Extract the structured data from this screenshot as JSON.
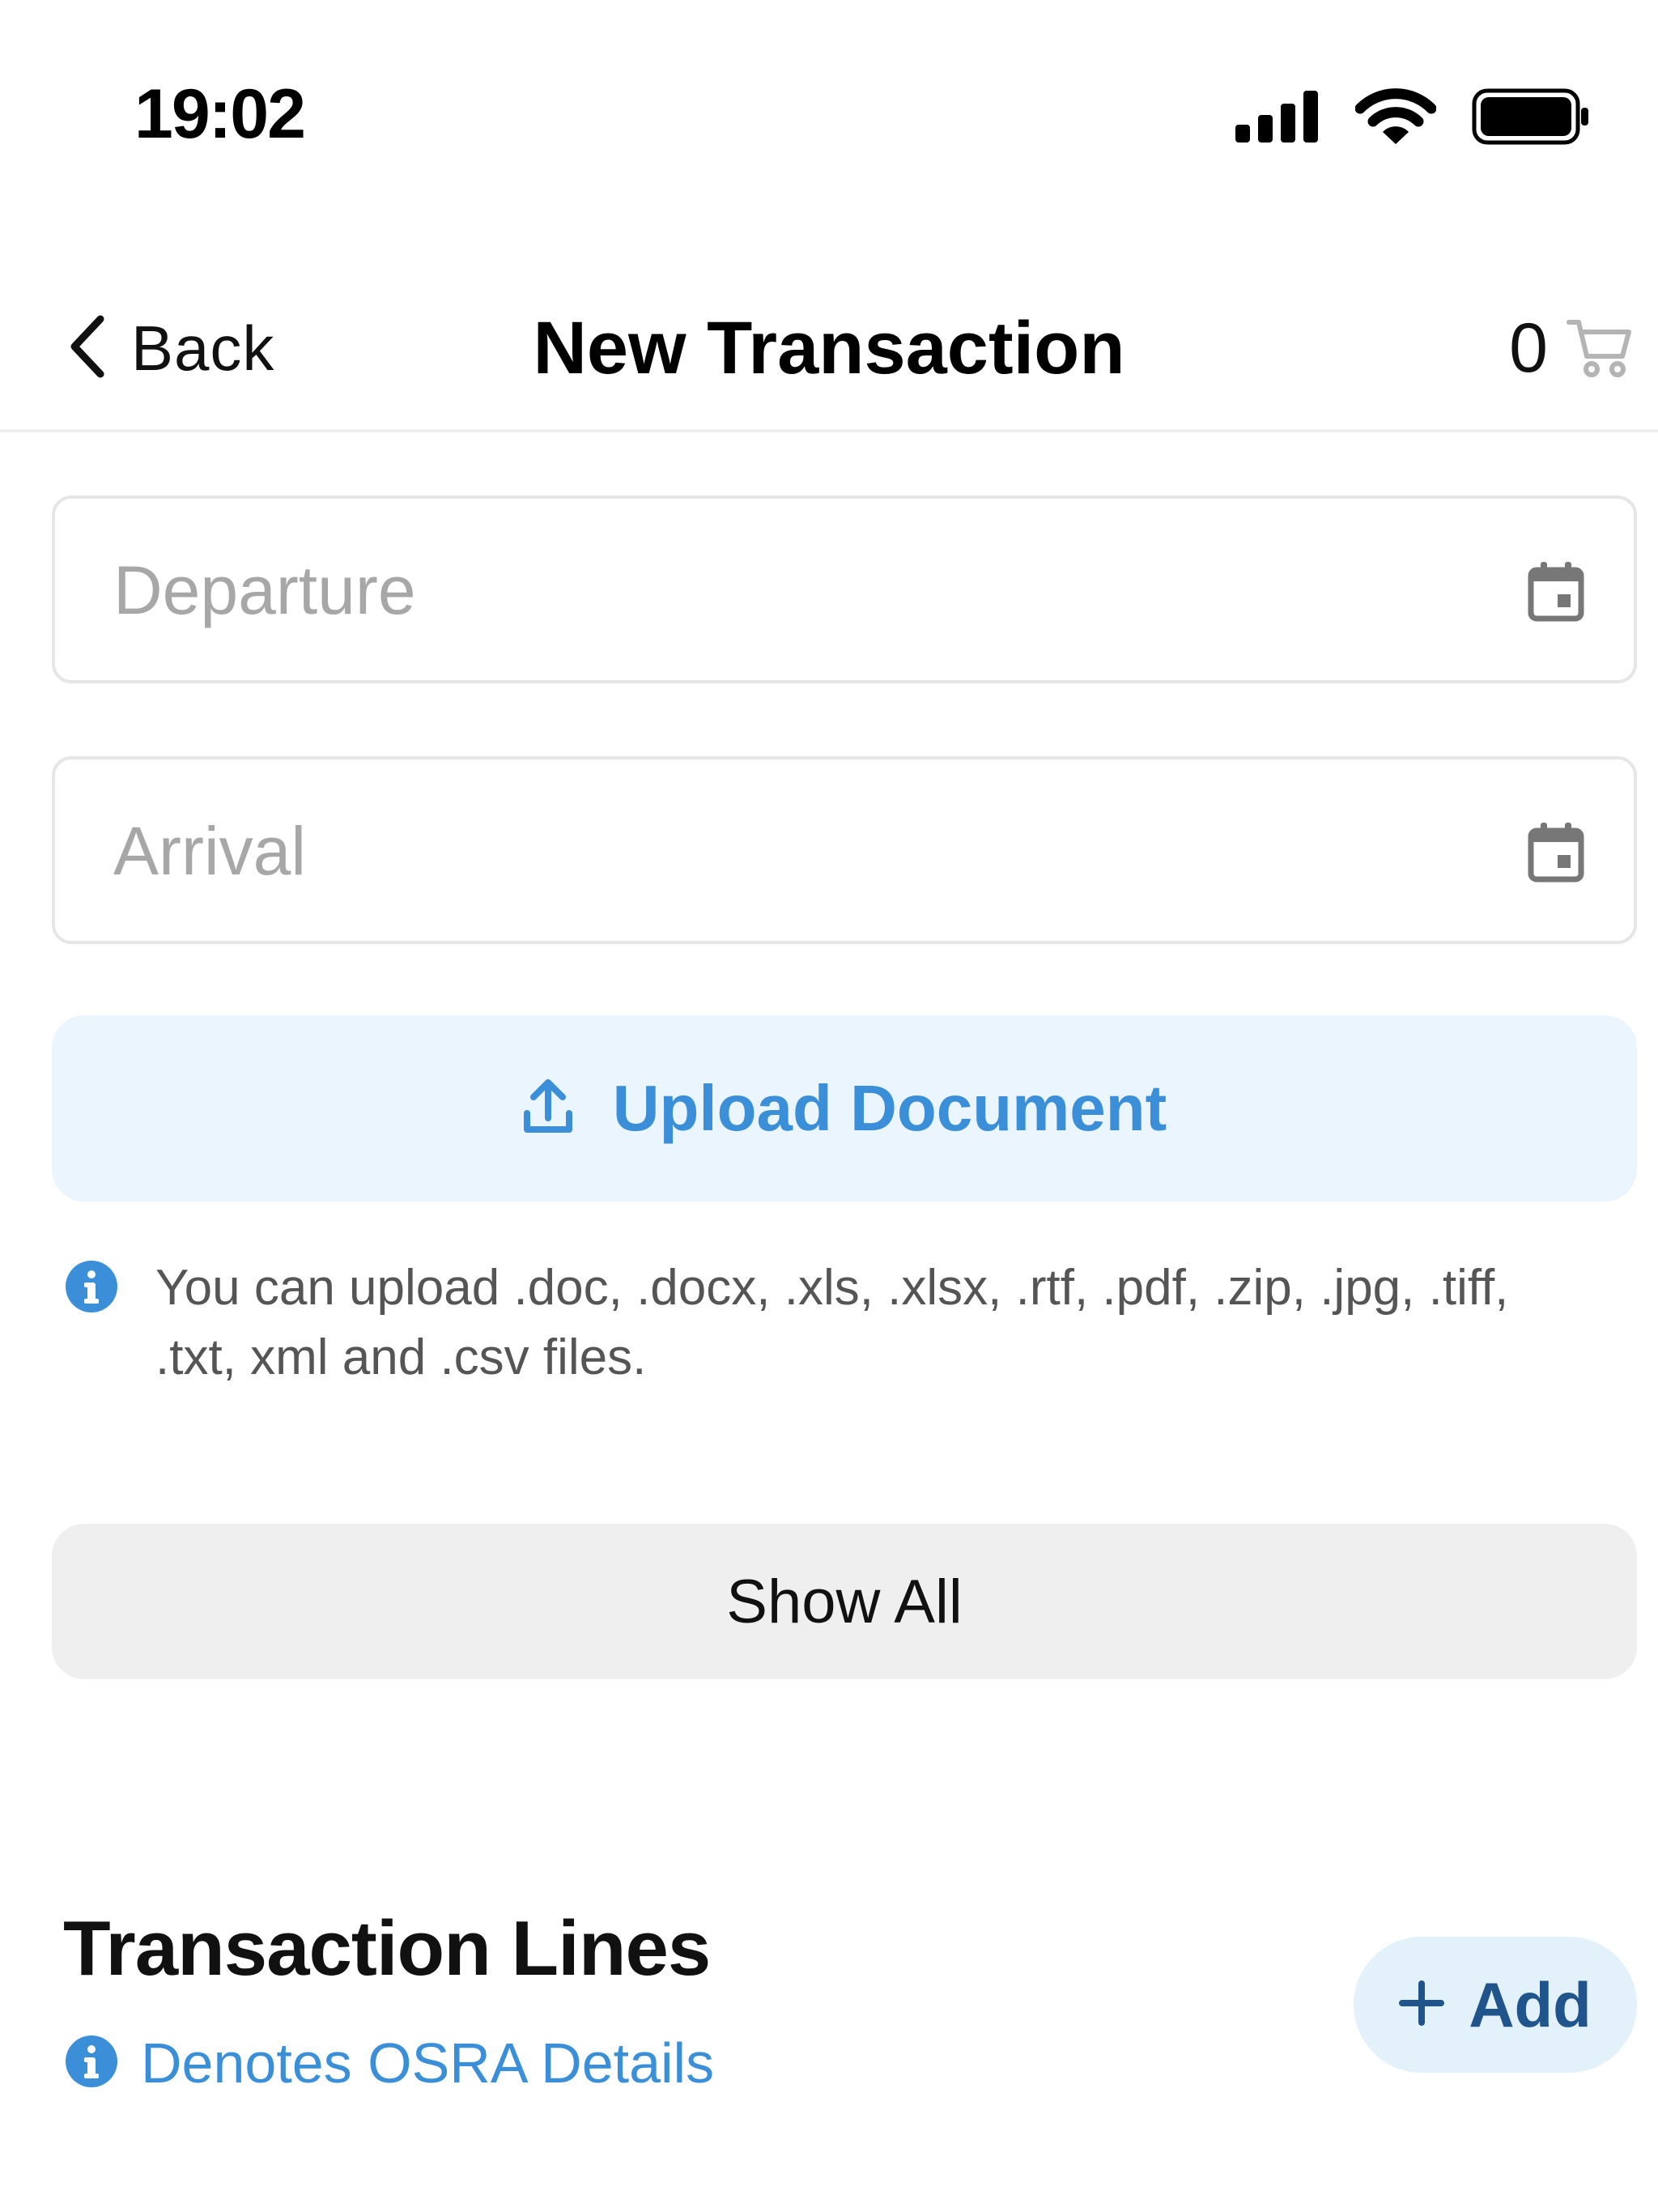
{
  "status_bar": {
    "time": "19:02",
    "icons": [
      "cellular-signal-icon",
      "wifi-icon",
      "battery-icon"
    ]
  },
  "nav": {
    "back_label": "Back",
    "title": "New Transaction",
    "cart_count": "0",
    "cart_icon": "cart-icon"
  },
  "form": {
    "departure": {
      "placeholder": "Departure",
      "value": "",
      "icon": "calendar-icon"
    },
    "arrival": {
      "placeholder": "Arrival",
      "value": "",
      "icon": "calendar-icon"
    }
  },
  "upload": {
    "label": "Upload Document",
    "icon": "upload-icon",
    "info_icon": "info-icon",
    "info_text": "You can upload .doc, .docx, .xls, .xlsx, .rtf, .pdf, .zip, .jpg, .tiff, .txt, xml and .csv files."
  },
  "show_all": {
    "label": "Show All"
  },
  "transaction_lines": {
    "title": "Transaction Lines",
    "osra_note": "Denotes OSRA Details",
    "add_label": "Add",
    "add_icon": "plus-icon"
  },
  "colors": {
    "accent_blue": "#3a8fd8",
    "upload_bg": "#eaf5fd",
    "add_bg": "#e3f1fb",
    "add_text": "#20558c",
    "show_all_bg": "#efefef",
    "placeholder_gray": "#a7a7a7"
  }
}
